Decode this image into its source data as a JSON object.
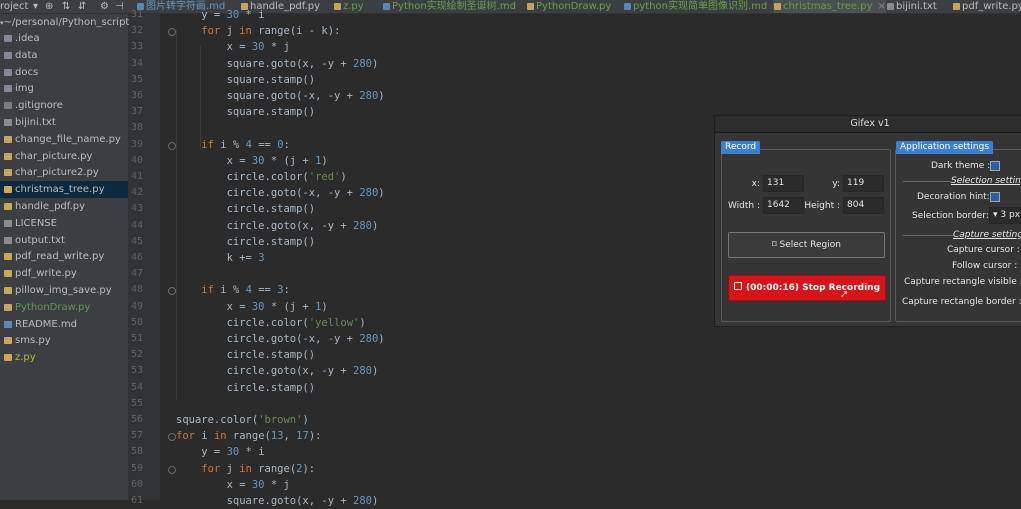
{
  "project_header": {
    "label": "roject",
    "arrow": "▾",
    "icons": [
      "target-icon",
      "collapse-icon",
      "expand-icon",
      "gear-icon",
      "hide-icon"
    ]
  },
  "tabs": [
    {
      "label": "图片转字符画.md",
      "type": "md"
    },
    {
      "label": "handle_pdf.py",
      "type": "py"
    },
    {
      "label": "z.py",
      "type": "py"
    },
    {
      "label": "Python实现绘制圣诞树.md",
      "type": "md"
    },
    {
      "label": "PythonDraw.py",
      "type": "py"
    },
    {
      "label": "python实现简单图像识别.md",
      "type": "md"
    },
    {
      "label": "christmas_tree.py",
      "type": "py"
    },
    {
      "label": "bijini.txt",
      "type": "txt"
    },
    {
      "label": "pdf_write.py",
      "type": "py"
    }
  ],
  "sidebar": {
    "path": "~/personal/Python_script",
    "items": [
      {
        "label": ".idea",
        "icon": "folder"
      },
      {
        "label": "data",
        "icon": "folder"
      },
      {
        "label": "docs",
        "icon": "folder"
      },
      {
        "label": "img",
        "icon": "folder"
      },
      {
        "label": ".gitignore",
        "icon": "git"
      },
      {
        "label": "bijini.txt",
        "icon": "txt"
      },
      {
        "label": "change_file_name.py",
        "icon": "py"
      },
      {
        "label": "char_picture.py",
        "icon": "py"
      },
      {
        "label": "char_picture2.py",
        "icon": "py"
      },
      {
        "label": "christmas_tree.py",
        "icon": "py"
      },
      {
        "label": "handle_pdf.py",
        "icon": "py"
      },
      {
        "label": "LICENSE",
        "icon": "txt"
      },
      {
        "label": "output.txt",
        "icon": "txt"
      },
      {
        "label": "pdf_read_write.py",
        "icon": "py"
      },
      {
        "label": "pdf_write.py",
        "icon": "py"
      },
      {
        "label": "pillow_img_save.py",
        "icon": "py"
      },
      {
        "label": "PythonDraw.py",
        "icon": "py"
      },
      {
        "label": "README.md",
        "icon": "md"
      },
      {
        "label": "sms.py",
        "icon": "py"
      },
      {
        "label": "z.py",
        "icon": "py"
      }
    ]
  },
  "editor": {
    "lines": [
      {
        "n": "31",
        "code": "    y = 30 * i"
      },
      {
        "n": "32",
        "code": "    for j in range(i - k):"
      },
      {
        "n": "33",
        "code": "        x = 30 * j"
      },
      {
        "n": "34",
        "code": "        square.goto(x, -y + 280)"
      },
      {
        "n": "35",
        "code": "        square.stamp()"
      },
      {
        "n": "36",
        "code": "        square.goto(-x, -y + 280)"
      },
      {
        "n": "37",
        "code": "        square.stamp()"
      },
      {
        "n": "38",
        "code": ""
      },
      {
        "n": "39",
        "code": "    if i % 4 == 0:"
      },
      {
        "n": "40",
        "code": "        x = 30 * (j + 1)"
      },
      {
        "n": "41",
        "code": "        circle.color('red')"
      },
      {
        "n": "42",
        "code": "        circle.goto(-x, -y + 280)"
      },
      {
        "n": "43",
        "code": "        circle.stamp()"
      },
      {
        "n": "44",
        "code": "        circle.goto(x, -y + 280)"
      },
      {
        "n": "45",
        "code": "        circle.stamp()"
      },
      {
        "n": "46",
        "code": "        k += 3"
      },
      {
        "n": "47",
        "code": ""
      },
      {
        "n": "48",
        "code": "    if i % 4 == 3:"
      },
      {
        "n": "49",
        "code": "        x = 30 * (j + 1)"
      },
      {
        "n": "50",
        "code": "        circle.color('yellow')"
      },
      {
        "n": "51",
        "code": "        circle.goto(-x, -y + 280)"
      },
      {
        "n": "52",
        "code": "        circle.stamp()"
      },
      {
        "n": "53",
        "code": "        circle.goto(x, -y + 280)"
      },
      {
        "n": "54",
        "code": "        circle.stamp()"
      },
      {
        "n": "55",
        "code": ""
      },
      {
        "n": "56",
        "code": "square.color('brown')"
      },
      {
        "n": "57",
        "code": "for i in range(13, 17):"
      },
      {
        "n": "58",
        "code": "    y = 30 * i"
      },
      {
        "n": "59",
        "code": "    for j in range(2):"
      },
      {
        "n": "60",
        "code": "        x = 30 * j"
      },
      {
        "n": "61",
        "code": "        square.goto(x, -y + 280)"
      }
    ]
  },
  "gifex": {
    "title": "Gifex v1",
    "record": {
      "tab_label": "Record",
      "x_label": "x:",
      "x_value": "131",
      "y_label": "y:",
      "y_value": "119",
      "width_label": "Width :",
      "width_value": "1642",
      "height_label": "Height :",
      "height_value": "804",
      "select_region_label": "Select Region",
      "stop_label": "(00:00:16) Stop Recording"
    },
    "settings": {
      "tab_label": "Application settings",
      "dark_theme_label": "Dark theme :",
      "selection_settings_label": "Selection settings",
      "decoration_hint_label": "Decoration hint:",
      "selection_border_label": "Selection border:",
      "selection_border_value": "3 px",
      "capture_settings_label": "Capture settings",
      "capture_cursor_label": "Capture cursor :",
      "follow_cursor_label": "Follow cursor :",
      "capture_rect_visible_label": "Capture rectangle visible :",
      "capture_rect_border_label": "Capture rectangle border :"
    },
    "accent_color": "#3a7fd1",
    "stop_color": "#d81418"
  },
  "colors": {
    "editor_bg": "#2b2b2b",
    "sidebar_bg": "#3c3f41",
    "keyword": "#cc7832",
    "number": "#6897bb",
    "string": "#6a8759"
  }
}
